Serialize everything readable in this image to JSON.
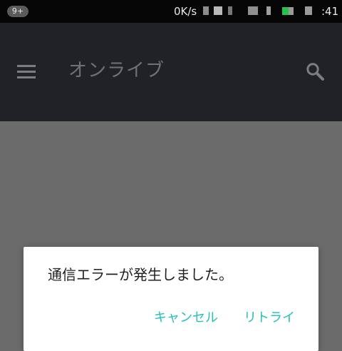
{
  "status_bar": {
    "notification_count": "9+",
    "network_speed": "0K/s",
    "time": ":41",
    "battery_color": "#27c24c"
  },
  "app_bar": {
    "title": "オンライブ",
    "menu_icon": "hamburger-menu-icon",
    "search_icon": "search-icon"
  },
  "dialog": {
    "message": "通信エラーが発生しました。",
    "buttons": {
      "cancel": "キャンセル",
      "retry": "リトライ"
    },
    "accent_color": "#22c2b8"
  }
}
